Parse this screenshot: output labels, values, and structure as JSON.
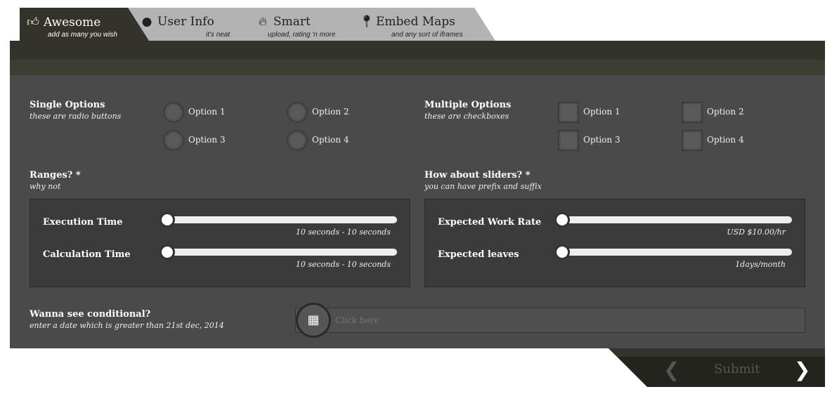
{
  "tabs": [
    {
      "title": "Awesome",
      "subtitle": "add as many you wish",
      "icon": "thumbs-up-icon"
    },
    {
      "title": "User Info",
      "subtitle": "it's neat",
      "icon": "user-icon"
    },
    {
      "title": "Smart",
      "subtitle": "upload, rating 'n more",
      "icon": "fire-icon"
    },
    {
      "title": "Embed Maps",
      "subtitle": "and any sort of iframes",
      "icon": "map-marker-icon"
    }
  ],
  "single": {
    "label": "Single Options",
    "sub": "these are radio buttons",
    "options": [
      "Option 1",
      "Option 2",
      "Option 3",
      "Option 4"
    ]
  },
  "multiple": {
    "label": "Multiple Options",
    "sub": "these are checkboxes",
    "options": [
      "Option 1",
      "Option 2",
      "Option 3",
      "Option 4"
    ]
  },
  "ranges": {
    "label": "Ranges?",
    "req": "*",
    "sub": "why not",
    "rows": [
      {
        "label": "Execution Time",
        "value": "10 seconds - 10 seconds"
      },
      {
        "label": "Calculation Time",
        "value": "10 seconds - 10 seconds"
      }
    ]
  },
  "sliders": {
    "label": "How about sliders?",
    "req": "*",
    "sub": "you can have prefix and suffix",
    "rows": [
      {
        "label": "Expected Work Rate",
        "value": "USD $10.00/hr"
      },
      {
        "label": "Expected leaves",
        "value": "1days/month"
      }
    ]
  },
  "conditional": {
    "label": "Wanna see conditional?",
    "sub": "enter a date which is greater than 21st dec, 2014",
    "placeholder": "Click here"
  },
  "footer": {
    "submit": "Submit"
  }
}
